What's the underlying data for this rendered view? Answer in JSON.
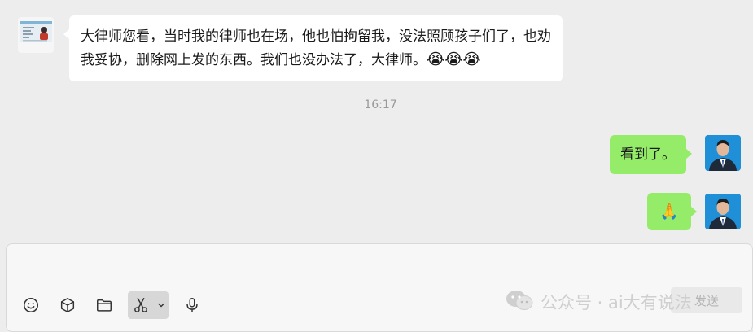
{
  "messages": [
    {
      "side": "left",
      "text": "大律师您看，当时我的律师也在场，他也怕拘留我，没法照顾孩子们了，也劝我妥协，删除网上发的东西。我们也没办法了，大律师。",
      "emoji": "😭😭😭"
    },
    {
      "side": "time",
      "text": "16:17"
    },
    {
      "side": "right",
      "text": "看到了。"
    },
    {
      "side": "right",
      "text": "🙏"
    }
  ],
  "toolbar": {
    "icons": [
      "emoji-icon",
      "cube-icon",
      "folder-icon",
      "scissors-icon",
      "chevron-down-icon",
      "microphone-icon"
    ]
  },
  "watermark": {
    "text": "公众号 · ai大有说法"
  },
  "send_button": {
    "label": "发送"
  },
  "colors": {
    "background": "#ededed",
    "left_bubble": "#ffffff",
    "right_bubble": "#95ec69",
    "timestamp": "#9a9a9a"
  }
}
